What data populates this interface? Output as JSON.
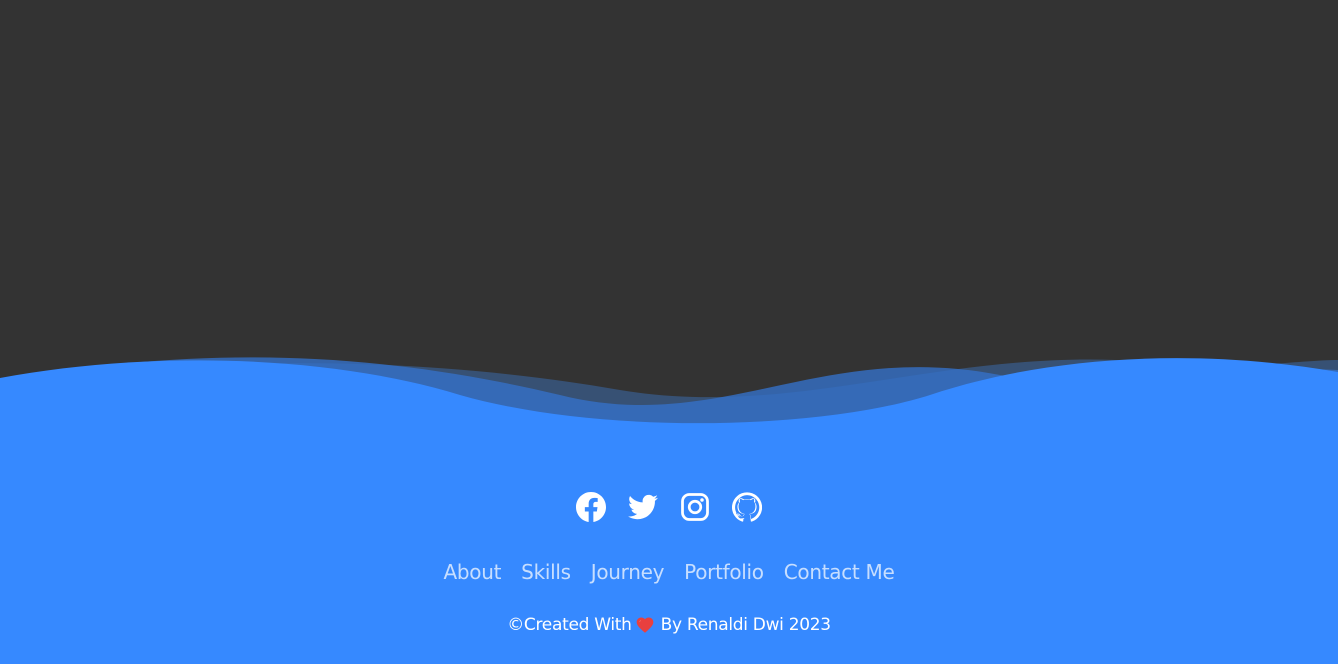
{
  "social": [
    {
      "name": "facebook-icon"
    },
    {
      "name": "twitter-icon"
    },
    {
      "name": "instagram-icon"
    },
    {
      "name": "github-icon"
    }
  ],
  "nav": {
    "about": "About",
    "skills": "Skills",
    "journey": "Journey",
    "portfolio": "Portfolio",
    "contact": "Contact Me"
  },
  "credit": {
    "prefix": "©Created With",
    "heart_icon": "heart-icon",
    "suffix": "By Renaldi Dwi 2023"
  },
  "colors": {
    "background": "#333333",
    "footer": "#3689ff",
    "text": "#ffffff",
    "heart": "#e8403f"
  }
}
